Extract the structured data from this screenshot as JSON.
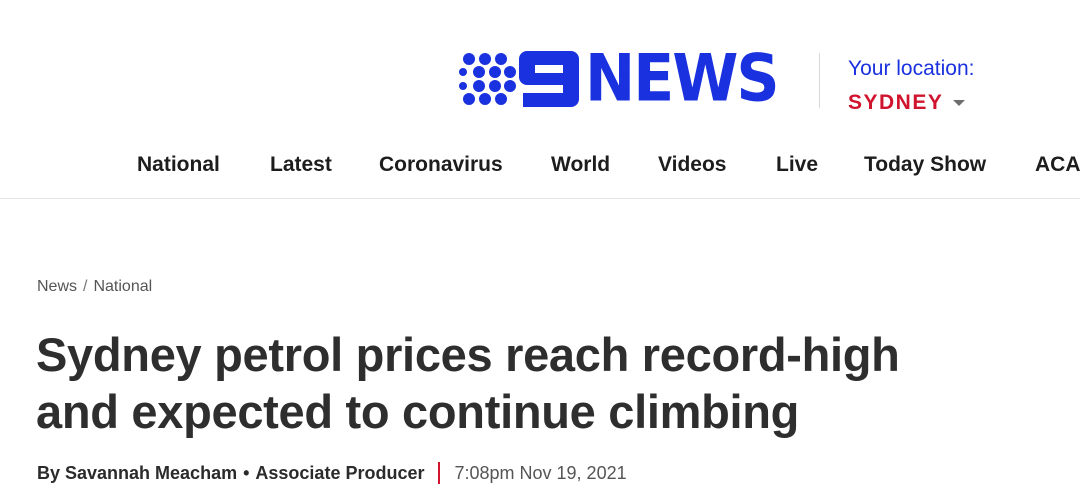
{
  "header": {
    "logo_text": "NEWS",
    "brand_color": "#1a31e0",
    "location": {
      "label": "Your location:",
      "city": "SYDNEY",
      "city_color": "#d0142e"
    }
  },
  "nav": {
    "items": [
      {
        "label": "National"
      },
      {
        "label": "Latest"
      },
      {
        "label": "Coronavirus"
      },
      {
        "label": "World"
      },
      {
        "label": "Videos"
      },
      {
        "label": "Live"
      },
      {
        "label": "Today Show"
      },
      {
        "label": "ACA"
      }
    ]
  },
  "breadcrumb": {
    "items": [
      "News",
      "National"
    ],
    "separator": "/"
  },
  "article": {
    "headline_line1": "Sydney petrol prices reach record-high",
    "headline_line2": "and expected to continue climbing",
    "author": "By Savannah Meacham",
    "separator": "•",
    "role": "Associate Producer",
    "timestamp": "7:08pm Nov 19, 2021"
  }
}
